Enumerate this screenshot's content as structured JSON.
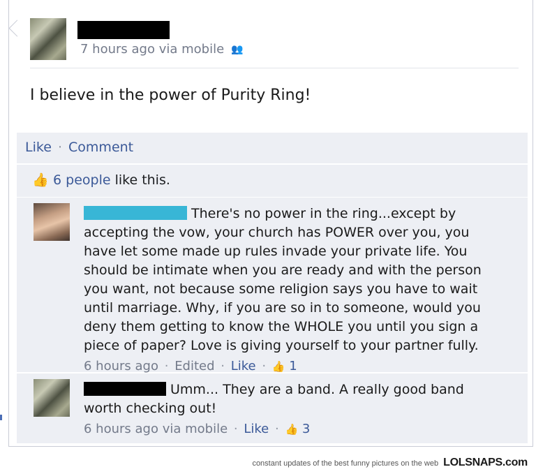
{
  "post": {
    "time": "7 hours ago via mobile",
    "text": "I believe in the power of Purity Ring!"
  },
  "actions": {
    "like": "Like",
    "sep": "·",
    "comment": "Comment"
  },
  "likes": {
    "count_link": "6 people",
    "rest": "like this."
  },
  "comments": [
    {
      "text": "There's no power in the ring...except by accepting the vow, your church has POWER over you, you have let some made up rules invade your private life. You should be intimate when you are ready and with the person you want, not because some religion says you have to wait until marriage. Why, if you are so in to someone, would you deny them getting to know the WHOLE you until you sign a piece of paper? Love is giving yourself to your partner fully.",
      "time": "6 hours ago",
      "edited": "Edited",
      "like": "Like",
      "like_count": "1"
    },
    {
      "text": "Umm... They are a band. A really good band worth checking out!",
      "time": "6 hours ago via mobile",
      "like": "Like",
      "like_count": "3"
    }
  ],
  "footer": {
    "tagline": "constant updates of the best funny pictures on the web",
    "brand": "LOLSNAPS.com"
  },
  "icons": {
    "audience": "people-icon",
    "like": "thumbs-up-icon"
  }
}
